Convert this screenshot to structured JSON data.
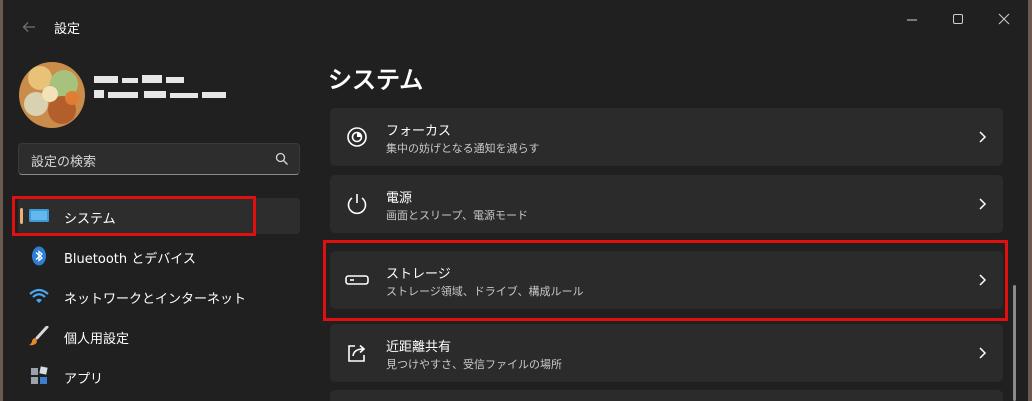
{
  "window": {
    "title": "設定"
  },
  "search": {
    "placeholder": "設定の検索"
  },
  "sidebar": {
    "items": [
      {
        "label": "システム",
        "icon": "monitor-icon",
        "selected": true
      },
      {
        "label": "Bluetooth とデバイス",
        "icon": "bluetooth-icon",
        "selected": false
      },
      {
        "label": "ネットワークとインターネット",
        "icon": "wifi-icon",
        "selected": false
      },
      {
        "label": "個人用設定",
        "icon": "brush-icon",
        "selected": false
      },
      {
        "label": "アプリ",
        "icon": "apps-icon",
        "selected": false
      }
    ]
  },
  "main": {
    "title": "システム",
    "cards": [
      {
        "title": "フォーカス",
        "subtitle": "集中の妨げとなる通知を減らす",
        "icon": "focus-icon"
      },
      {
        "title": "電源",
        "subtitle": "画面とスリープ、電源モード",
        "icon": "power-icon"
      },
      {
        "title": "ストレージ",
        "subtitle": "ストレージ領域、ドライブ、構成ルール",
        "icon": "storage-icon"
      },
      {
        "title": "近距離共有",
        "subtitle": "見つけやすさ、受信ファイルの場所",
        "icon": "share-icon"
      }
    ]
  },
  "colors": {
    "background": "#202020",
    "card": "#2b2b2b",
    "accent_indicator": "#e8b27a",
    "highlight_box": "#e01010"
  }
}
